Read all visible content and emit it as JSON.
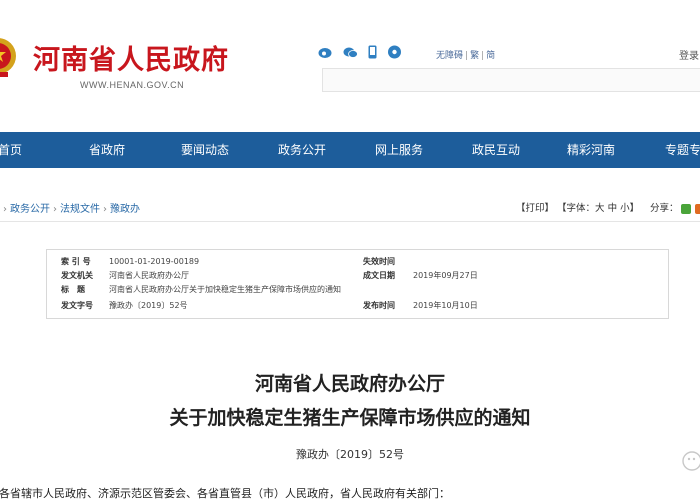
{
  "header": {
    "site_title": "河南省人民政府",
    "domain": "WWW.HENAN.GOV.CN",
    "tools": [
      "无障碍",
      "繁",
      "简"
    ],
    "login": "登录",
    "icons": [
      "weibo-icon",
      "wechat-icon",
      "mobile-icon",
      "rss-icon"
    ]
  },
  "nav": {
    "items": [
      "首页",
      "省政府",
      "要闻动态",
      "政务公开",
      "网上服务",
      "政民互动",
      "精彩河南",
      "专题专"
    ]
  },
  "breadcrumb": {
    "items": [
      "政务公开",
      "法规文件",
      "豫政办"
    ],
    "print": "【打印】",
    "font": "【字体：大 中 小】",
    "share": "分享："
  },
  "info": {
    "index_label": "索 引 号",
    "index_value": "10001-01-2019-00189",
    "invalid_label": "失效时间",
    "invalid_value": "",
    "issuer_label": "发文机关",
    "issuer_value": "河南省人民政府办公厅",
    "created_label": "成文日期",
    "created_value": "2019年09月27日",
    "title_label": "标　题",
    "title_value": "河南省人民政府办公厅关于加快稳定生猪生产保障市场供应的通知",
    "docno_label": "发文字号",
    "docno_value": "豫政办〔2019〕52号",
    "publish_label": "发布时间",
    "publish_value": "2019年10月10日"
  },
  "article": {
    "title_line1": "河南省人民政府办公厅",
    "title_line2": "关于加快稳定生猪生产保障市场供应的通知",
    "doc_number": "豫政办〔2019〕52号",
    "addressee": "各省辖市人民政府、济源示范区管委会、各省直管县（市）人民政府，省人民政府有关部门："
  },
  "colors": {
    "brand_red": "#c8161d",
    "nav_blue": "#1d5d9b",
    "link_blue": "#2a6aa7"
  }
}
